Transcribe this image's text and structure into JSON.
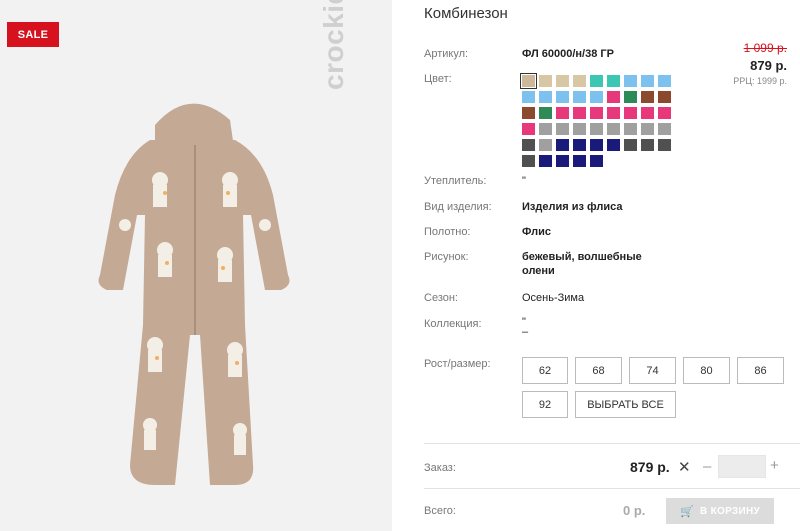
{
  "product": {
    "title": "Комбинезон",
    "sale_badge": "SALE",
    "brand": "crockid"
  },
  "attributes": {
    "article_label": "Артикул:",
    "article_value": "ФЛ 60000/н/38 ГР",
    "color_label": "Цвет:",
    "insulation_label": "Утеплитель:",
    "insulation_value": "\"",
    "type_label": "Вид изделия:",
    "type_value": "Изделия из флиса",
    "fabric_label": "Полотно:",
    "fabric_value": "Флис",
    "pattern_label": "Рисунок:",
    "pattern_value_line1": "бежевый, волшебные",
    "pattern_value_line2": "олени",
    "season_label": "Сезон:",
    "season_value": "Осень-Зима",
    "collection_label": "Коллекция:",
    "collection_value_line1": "\"",
    "collection_value_line2": "–"
  },
  "price": {
    "old": "1 099 р.",
    "new": "879 р.",
    "rrp": "РРЦ: 1999 р."
  },
  "swatch_colors": [
    "#cdb89a",
    "#d8c7a5",
    "#d8c7a5",
    "#d8c7a5",
    "#3cc7b5",
    "#3cc7b5",
    "#7dc1ef",
    "#7dc1ef",
    "#7dc1ef",
    "#7dc1ef",
    "#7dc1ef",
    "#7dc1ef",
    "#7dc1ef",
    "#7dc1ef",
    "#e8387c",
    "#2e8b57",
    "#8b4a2e",
    "#8b4a2e",
    "#8b4a2e",
    "#2e8b57",
    "#e8387c",
    "#e8387c",
    "#e8387c",
    "#e8387c",
    "#e8387c",
    "#e8387c",
    "#e8387c",
    "#e8387c",
    "#a0a0a0",
    "#a0a0a0",
    "#a0a0a0",
    "#a0a0a0",
    "#a0a0a0",
    "#a0a0a0",
    "#a0a0a0",
    "#a0a0a0",
    "#505050",
    "#a0a0a0",
    "#1a1a7a",
    "#1a1a7a",
    "#1a1a7a",
    "#1a1a7a",
    "#505050",
    "#505050",
    "#505050",
    "#505050",
    "#1a1a7a",
    "#1a1a7a",
    "#1a1a7a",
    "#1a1a7a"
  ],
  "sizes": {
    "label": "Рост/размер:",
    "options": [
      "62",
      "68",
      "74",
      "80",
      "86",
      "92"
    ],
    "select_all": "ВЫБРАТЬ ВСЕ"
  },
  "order": {
    "label": "Заказ:",
    "price": "879 р.",
    "times": "✕",
    "minus": "–",
    "plus": "+",
    "qty_value": ""
  },
  "total": {
    "label": "Всего:",
    "value": "0 р.",
    "cart_button": "В КОРЗИНУ"
  }
}
